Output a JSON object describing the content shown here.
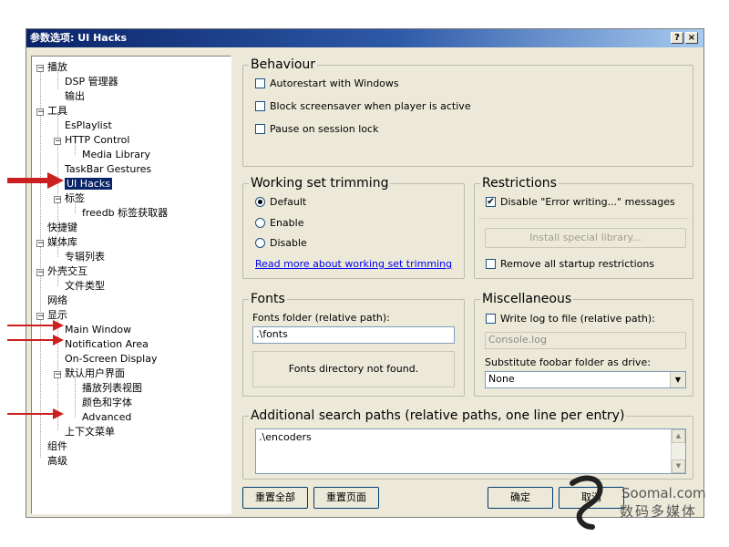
{
  "window": {
    "title": "参数选项: UI Hacks",
    "help_label": "?",
    "close_label": "×"
  },
  "tree": {
    "nodes": [
      {
        "label": "播放",
        "expander": "−"
      },
      {
        "label": "DSP 管理器"
      },
      {
        "label": "输出"
      },
      {
        "label": "工具",
        "expander": "−"
      },
      {
        "label": "EsPlaylist"
      },
      {
        "label": "HTTP Control",
        "expander": "−"
      },
      {
        "label": "Media Library"
      },
      {
        "label": "TaskBar Gestures"
      },
      {
        "label": "UI Hacks",
        "selected": true
      },
      {
        "label": "标签",
        "expander": "−"
      },
      {
        "label": "freedb 标签获取器"
      },
      {
        "label": "快捷键"
      },
      {
        "label": "媒体库",
        "expander": "−"
      },
      {
        "label": "专辑列表"
      },
      {
        "label": "外壳交互",
        "expander": "−"
      },
      {
        "label": "文件类型"
      },
      {
        "label": "网络"
      },
      {
        "label": "显示",
        "expander": "−"
      },
      {
        "label": "Main Window"
      },
      {
        "label": "Notification Area"
      },
      {
        "label": "On-Screen Display"
      },
      {
        "label": "默认用户界面",
        "expander": "−"
      },
      {
        "label": "播放列表视图"
      },
      {
        "label": "颜色和字体"
      },
      {
        "label": "Advanced"
      },
      {
        "label": "上下文菜单"
      },
      {
        "label": "组件"
      },
      {
        "label": "高级"
      }
    ]
  },
  "behaviour": {
    "title": "Behaviour",
    "autorestart": "Autorestart with Windows",
    "block_screensaver": "Block screensaver when player is active",
    "pause_on_lock": "Pause on session lock"
  },
  "working_set": {
    "title": "Working set trimming",
    "options": [
      "Default",
      "Enable",
      "Disable"
    ],
    "selected": "Default",
    "link": "Read more about working set trimming"
  },
  "restrictions": {
    "title": "Restrictions",
    "disable_error": "Disable \"Error writing...\" messages",
    "disable_error_checked": true,
    "install_button": "Install special library...",
    "remove_startup": "Remove all startup restrictions"
  },
  "fonts": {
    "title": "Fonts",
    "folder_label": "Fonts folder (relative path):",
    "folder_value": ".\\fonts",
    "status": "Fonts directory not found."
  },
  "misc": {
    "title": "Miscellaneous",
    "write_log_label": "Write log to file (relative path):",
    "log_value": "Console.log",
    "substitute_label": "Substitute foobar folder as drive:",
    "drive_value": "None"
  },
  "search_paths": {
    "title": "Additional search paths (relative paths, one line per entry)",
    "value": ".\\encoders"
  },
  "footer": {
    "reset_all": "重置全部",
    "reset_page": "重置页面",
    "ok": "确定",
    "cancel": "取消"
  },
  "watermark": {
    "line1": "Soomal.com",
    "line2": "数码多媒体"
  },
  "colors": {
    "arrow": "#cc1f1f",
    "selection": "#0a246a",
    "titlebar": "#0a246a"
  }
}
